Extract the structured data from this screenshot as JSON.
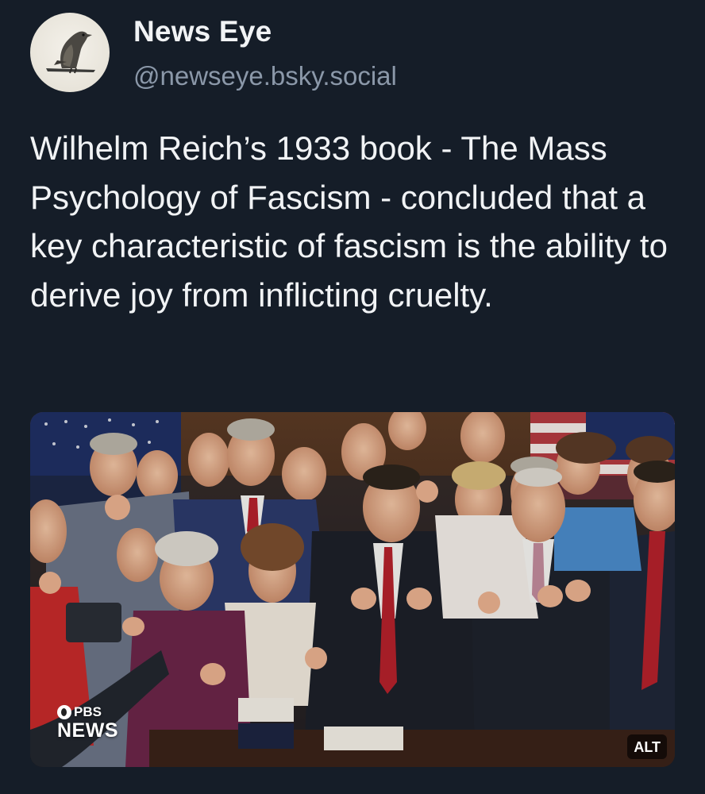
{
  "author": {
    "display_name": "News Eye",
    "handle": "@newseye.bsky.social",
    "avatar_icon": "hawk-icon"
  },
  "post": {
    "text": "Wilhelm Reich’s 1933 book - The Mass Psychology of Fascism - concluded that a key characteristic of fascism is the ability to derive joy from inflicting cruelty."
  },
  "media": {
    "watermark_brand": "PBS",
    "watermark_news": "NEWS",
    "alt_label": "ALT"
  },
  "colors": {
    "background": "#151d28",
    "text_primary": "#f1f3f5",
    "text_secondary": "#8b98a9"
  }
}
